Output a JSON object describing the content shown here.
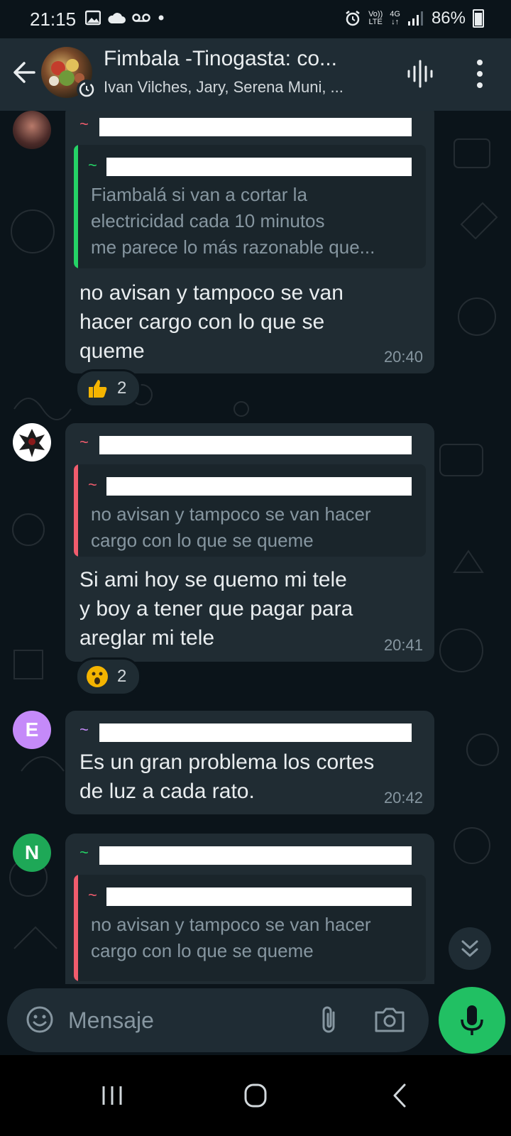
{
  "status_bar": {
    "time": "21:15",
    "network_top": "Vo))",
    "network_bottom": "LTE",
    "signal_type": "4G",
    "battery": "86%",
    "icons": [
      "image-icon",
      "cloud-icon",
      "voicemail-icon",
      "dot-icon",
      "alarm-icon",
      "signal-icon",
      "battery-icon"
    ]
  },
  "header": {
    "title": "Fimbala -Tinogasta: co...",
    "subtitle": "Ivan Vilches, Jary, Serena Muni, ..."
  },
  "messages": [
    {
      "tilde": "~",
      "sender_color": "#f15c6d",
      "quote": {
        "tilde": "~",
        "accent": "#25d366",
        "lines": [
          "Fiambalá si van a cortar la",
          "electricidad cada 10 minutos",
          "me parece lo más razonable que..."
        ]
      },
      "lines": [
        "no avisan y tampoco se van",
        "hacer cargo con lo que se",
        "queme"
      ],
      "time": "20:40",
      "reaction": {
        "emoji": "thumbs-up-icon",
        "count": "2"
      }
    },
    {
      "tilde": "~",
      "sender_color": "#f15c6d",
      "quote": {
        "tilde": "~",
        "accent": "#f15c6d",
        "lines": [
          "no avisan y tampoco se van hacer",
          "cargo con lo que se queme"
        ]
      },
      "lines": [
        "Si ami hoy se quemo mi tele",
        "y boy a tener que pagar para",
        "areglar mi tele"
      ],
      "time": "20:41",
      "reaction": {
        "emoji": "surprised-face-icon",
        "count": "2"
      }
    },
    {
      "avatar_letter": "E",
      "avatar_color": "#c58af9",
      "tilde": "~",
      "sender_color": "#c58af9",
      "lines": [
        "Es un gran problema los cortes",
        "de luz a cada rato."
      ],
      "time": "20:42"
    },
    {
      "avatar_letter": "N",
      "avatar_color": "#25d366",
      "tilde": "~",
      "sender_color": "#25d366",
      "quote": {
        "tilde": "~",
        "accent": "#f15c6d",
        "lines": [
          "no avisan y tampoco se van hacer",
          "cargo con lo que se queme"
        ]
      }
    }
  ],
  "input": {
    "placeholder": "Mensaje"
  },
  "colors": {
    "background": "#0b141a",
    "bubble": "#202c33",
    "header": "#1f2c34",
    "accent_green": "#21c063"
  }
}
